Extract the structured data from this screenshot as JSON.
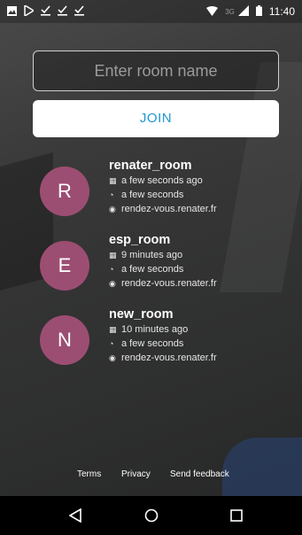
{
  "status_bar": {
    "left_icons": [
      "image-icon",
      "play-store-icon",
      "download-done-icon",
      "download-done-icon",
      "download-done-icon"
    ],
    "network_label": "3G",
    "time": "11:40"
  },
  "join": {
    "placeholder": "Enter room name",
    "value": "",
    "button_label": "JOIN"
  },
  "rooms": [
    {
      "initial": "R",
      "name": "renater_room",
      "created": "a few seconds ago",
      "duration": "a few seconds",
      "server": "rendez-vous.renater.fr"
    },
    {
      "initial": "E",
      "name": "esp_room",
      "created": "9 minutes ago",
      "duration": "a few seconds",
      "server": "rendez-vous.renater.fr"
    },
    {
      "initial": "N",
      "name": "new_room",
      "created": "10 minutes ago",
      "duration": "a few seconds",
      "server": "rendez-vous.renater.fr"
    }
  ],
  "footer": {
    "terms": "Terms",
    "privacy": "Privacy",
    "feedback": "Send feedback"
  },
  "colors": {
    "avatar": "#9c4e72",
    "join_text": "#2196d3"
  }
}
